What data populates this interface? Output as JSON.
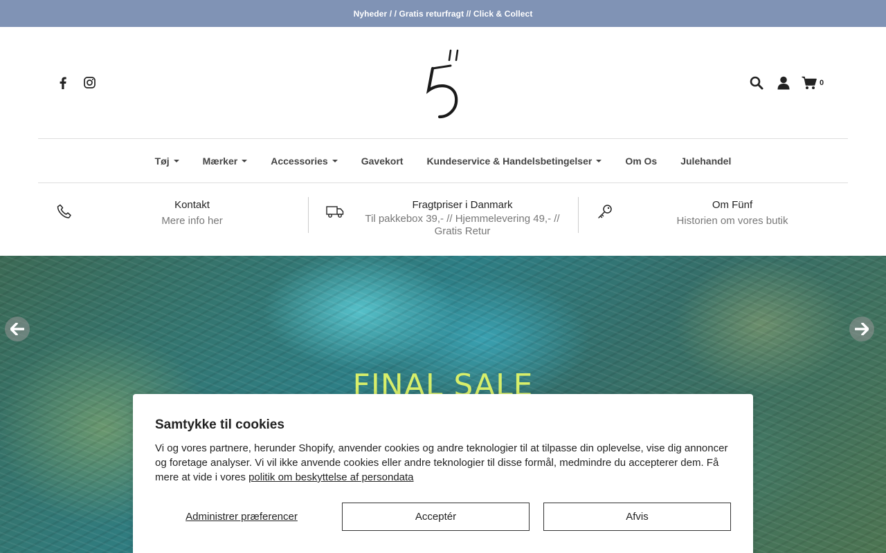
{
  "announcement": {
    "text": "Nyheder / / Gratis returfragt // Click & Collect"
  },
  "header": {
    "social": [
      "facebook-icon",
      "instagram-icon"
    ],
    "tools": [
      "search-icon",
      "account-icon",
      "cart-icon"
    ],
    "cart_count": "0"
  },
  "nav": {
    "items": [
      {
        "label": "Tøj",
        "dropdown": true
      },
      {
        "label": "Mærker",
        "dropdown": true
      },
      {
        "label": "Accessories",
        "dropdown": true
      },
      {
        "label": "Gavekort",
        "dropdown": false
      },
      {
        "label": "Kundeservice & Handelsbetingelser",
        "dropdown": true
      },
      {
        "label": "Om Os",
        "dropdown": false
      },
      {
        "label": "Julehandel",
        "dropdown": false
      }
    ]
  },
  "info": [
    {
      "icon": "phone-icon",
      "title": "Kontakt",
      "subtitle": "Mere info her"
    },
    {
      "icon": "truck-icon",
      "title": "Fragtpriser i Danmark",
      "subtitle": "Til pakkebox 39,- // Hjemmelevering 49,- // Gratis Retur"
    },
    {
      "icon": "key-icon",
      "title": "Om Fünf",
      "subtitle": "Historien om vores butik"
    }
  ],
  "hero": {
    "title": "FINAL SALE"
  },
  "cookie": {
    "title": "Samtykke til cookies",
    "text": "Vi og vores partnere, herunder Shopify, anvender cookies og andre teknologier til at tilpasse din oplevelse, vise dig annoncer og foretage analyser. Vi vil ikke anvende cookies eller andre teknologier til disse formål, medmindre du accepterer dem. Få mere at vide i vores ",
    "link": "politik om beskyttelse af persondata",
    "manage": "Administrer præferencer",
    "accept": "Acceptér",
    "decline": "Afvis"
  },
  "colors": {
    "announce_bg": "#8093b5",
    "hero_title": "#d8ef6a"
  }
}
